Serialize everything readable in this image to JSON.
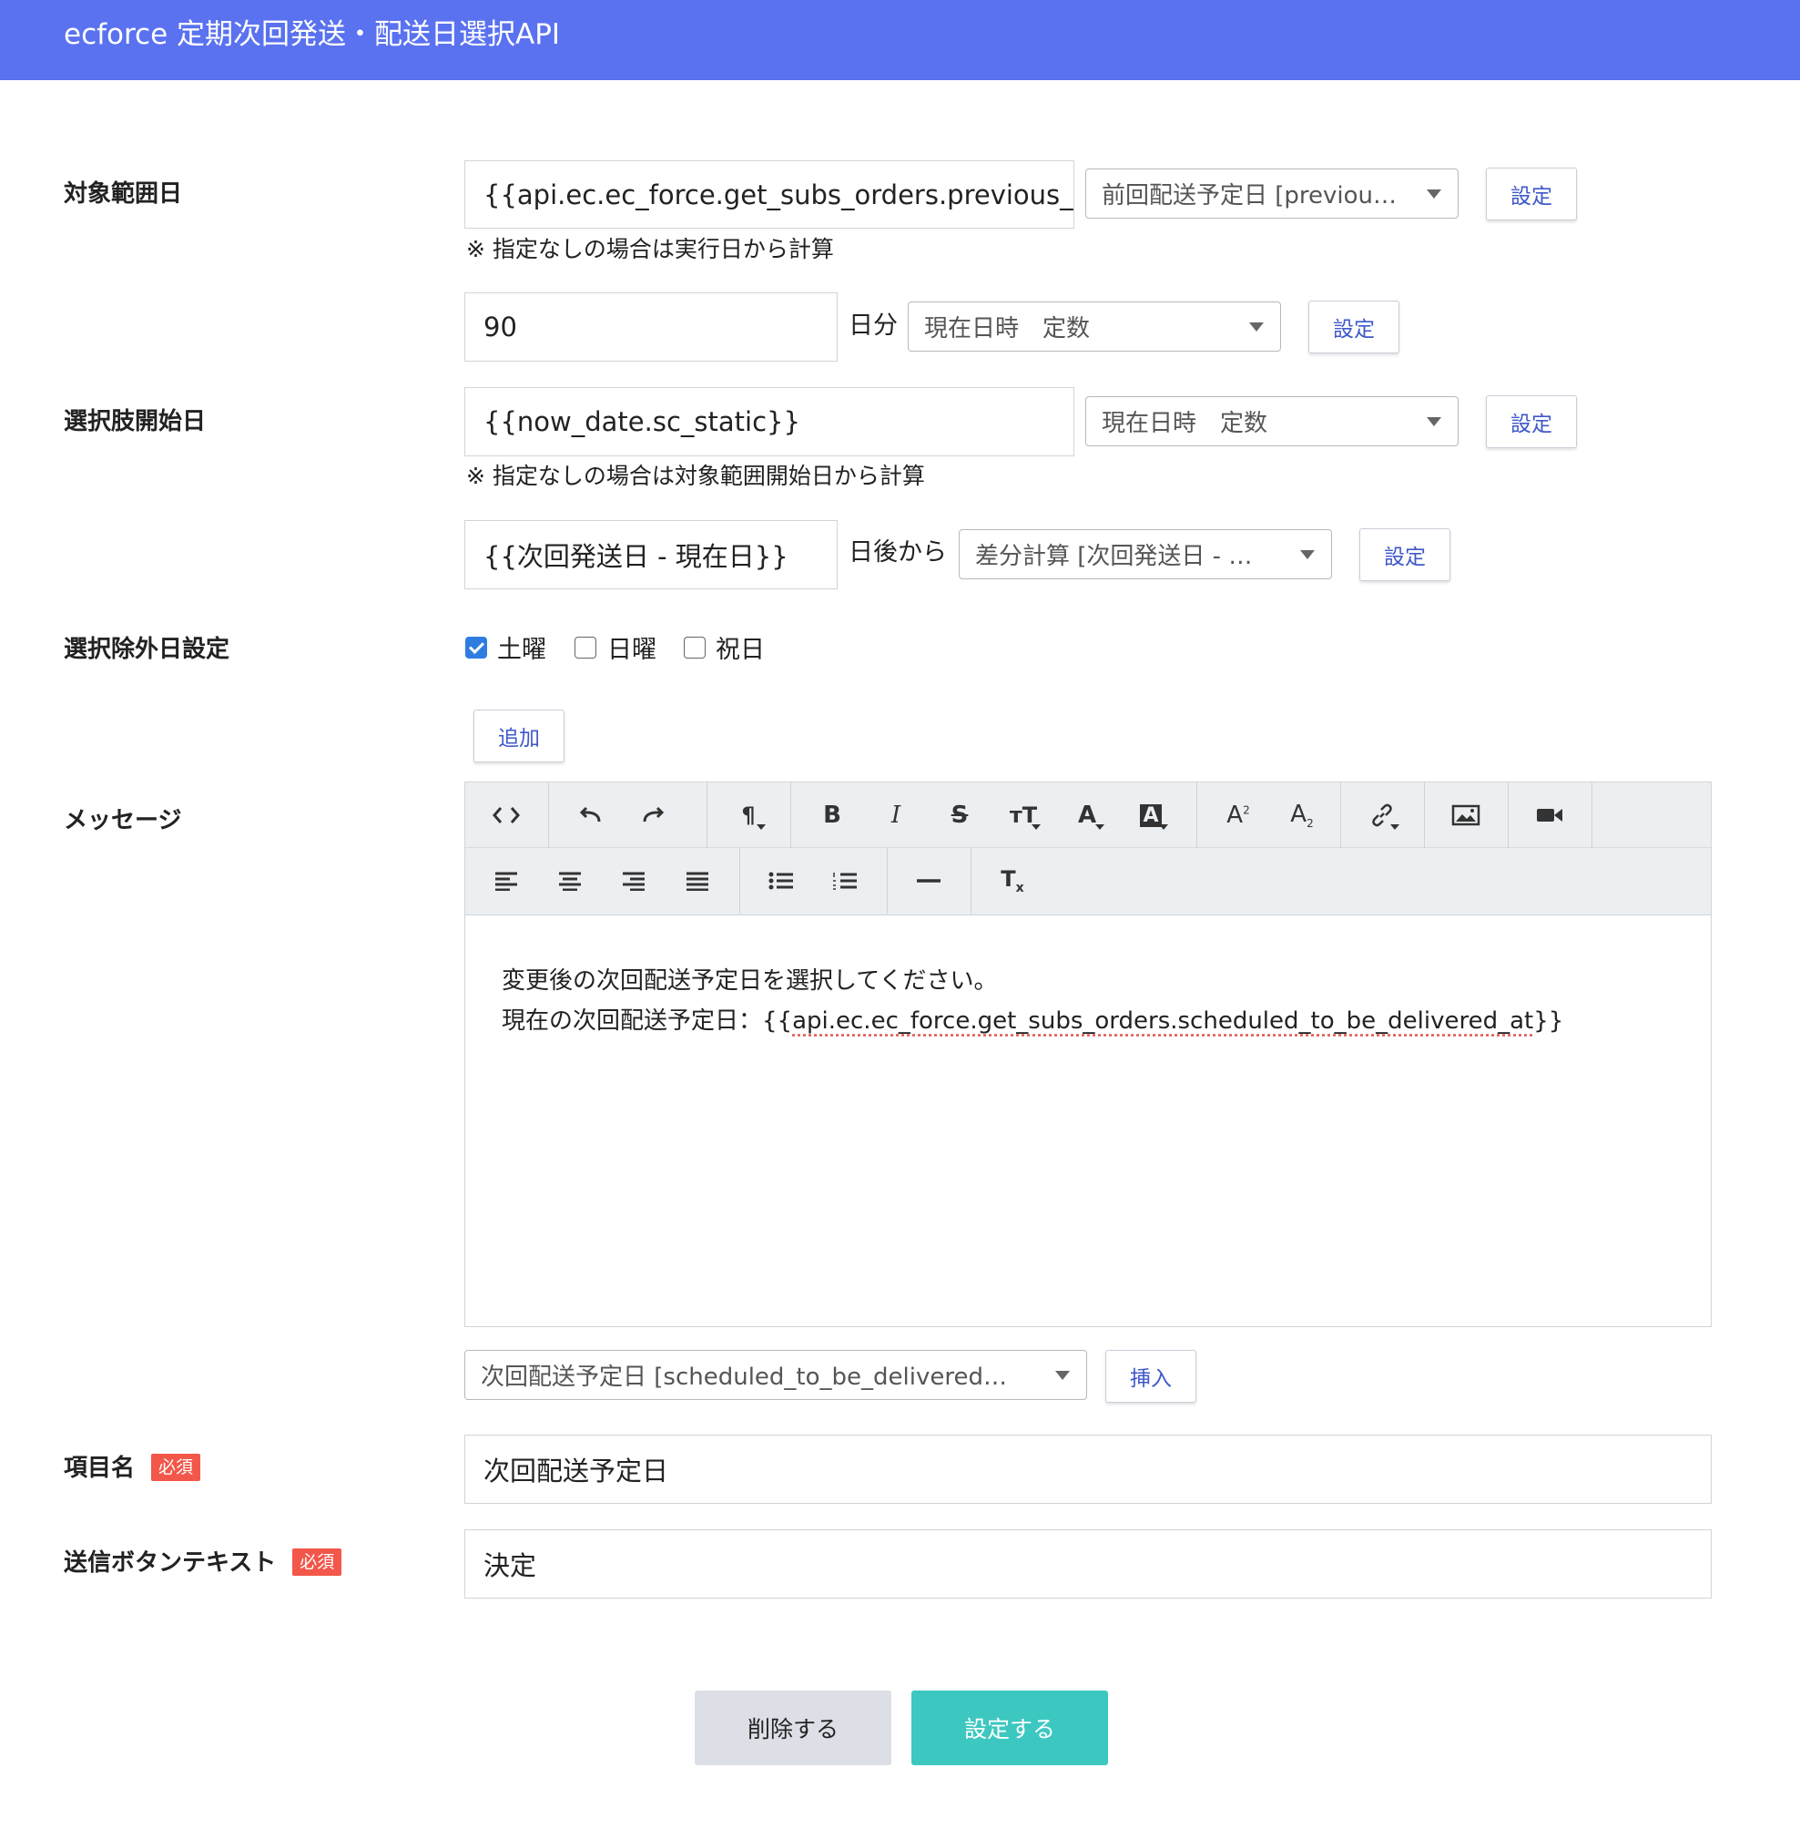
{
  "header": {
    "title": "ecforce 定期次回発送・配送日選択API"
  },
  "target_range": {
    "label": "対象範囲日",
    "date_value": "{{api.ec.ec_force.get_subs_orders.previous_",
    "date_select": "前回配送予定日 [previou…",
    "set_label": "設定",
    "note": "※ 指定なしの場合は実行日から計算",
    "days_value": "90",
    "days_suffix": "日分",
    "days_select": "現在日時　定数",
    "days_set_label": "設定"
  },
  "option_start": {
    "label": "選択肢開始日",
    "date_value": "{{now_date.sc_static}}",
    "date_select": "現在日時　定数",
    "set_label": "設定",
    "note": "※ 指定なしの場合は対象範囲開始日から計算",
    "offset_value": "{{次回発送日 - 現在日}}",
    "offset_suffix": "日後から",
    "offset_select": "差分計算 [次回発送日 - …",
    "offset_set_label": "設定"
  },
  "exclusions": {
    "label": "選択除外日設定",
    "options": [
      {
        "label": "土曜",
        "checked": true
      },
      {
        "label": "日曜",
        "checked": false
      },
      {
        "label": "祝日",
        "checked": false
      }
    ],
    "add_label": "追加"
  },
  "message": {
    "label": "メッセージ",
    "toolbar_icons": [
      "code-view-icon",
      "undo-icon",
      "redo-icon",
      "paragraph-icon",
      "bold-icon",
      "italic-icon",
      "strikethrough-icon",
      "font-size-icon",
      "text-color-icon",
      "background-color-icon",
      "superscript-icon",
      "subscript-icon",
      "link-icon",
      "image-icon",
      "video-icon",
      "align-left-icon",
      "align-center-icon",
      "align-right-icon",
      "align-justify-icon",
      "bullet-list-icon",
      "numbered-list-icon",
      "horizontal-rule-icon",
      "clear-format-icon"
    ],
    "line1": "変更後の次回配送予定日を選択してください。",
    "line2_prefix": "現在の次回配送予定日：{{",
    "line2_var": "api.ec.ec_force.get_subs_orders.scheduled_to_be_delivered_at",
    "line2_suffix": "}}",
    "var_select": "次回配送予定日 [scheduled_to_be_delivered…",
    "insert_label": "挿入"
  },
  "item_name": {
    "label": "項目名",
    "required": "必須",
    "value": "次回配送予定日"
  },
  "submit_text": {
    "label": "送信ボタンテキスト",
    "required": "必須",
    "value": "決定"
  },
  "actions": {
    "delete_label": "削除する",
    "save_label": "設定する"
  },
  "colors": {
    "header": "#5a72f0",
    "accent": "#3f58c9",
    "required": "#f2574a",
    "save": "#3cc8c0",
    "delete": "#dcdfe5"
  }
}
